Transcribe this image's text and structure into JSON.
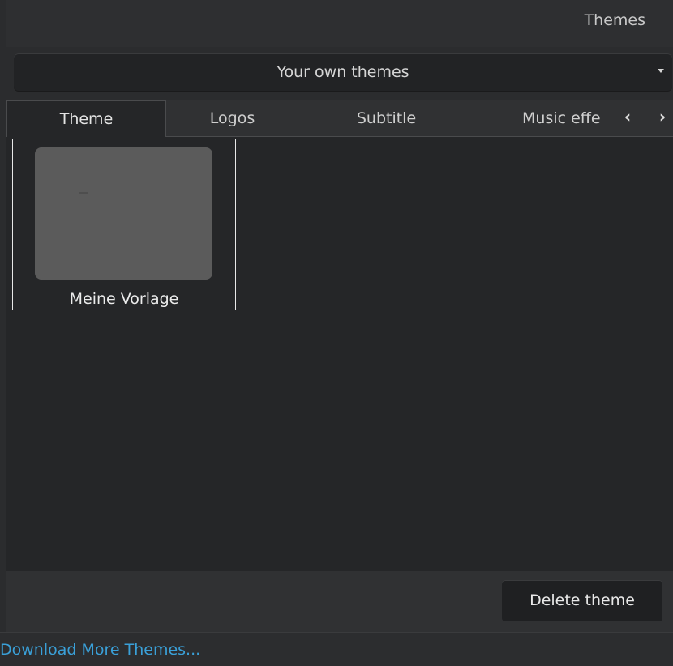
{
  "header": {
    "title": "Themes"
  },
  "category_dropdown": {
    "selected": "Your own themes",
    "arrow_icon": "caret-down-icon"
  },
  "tabs": [
    {
      "label": "Theme",
      "active": true
    },
    {
      "label": "Logos",
      "active": false
    },
    {
      "label": "Subtitle",
      "active": false
    },
    {
      "label": "Music effe",
      "active": false
    }
  ],
  "tab_scroll": {
    "left_icon": "chevron-left-icon",
    "right_icon": "chevron-right-icon",
    "left_glyph": "‹",
    "right_glyph": "›"
  },
  "themes": [
    {
      "name": "Meine Vorlage",
      "selected": true
    }
  ],
  "footer": {
    "delete_label": "Delete theme"
  },
  "bottom": {
    "download_label": "Download More Themes..."
  },
  "colors": {
    "background": "#2b2c2e",
    "link": "#3aa0d8",
    "thumbnail": "#5b5b5b"
  }
}
